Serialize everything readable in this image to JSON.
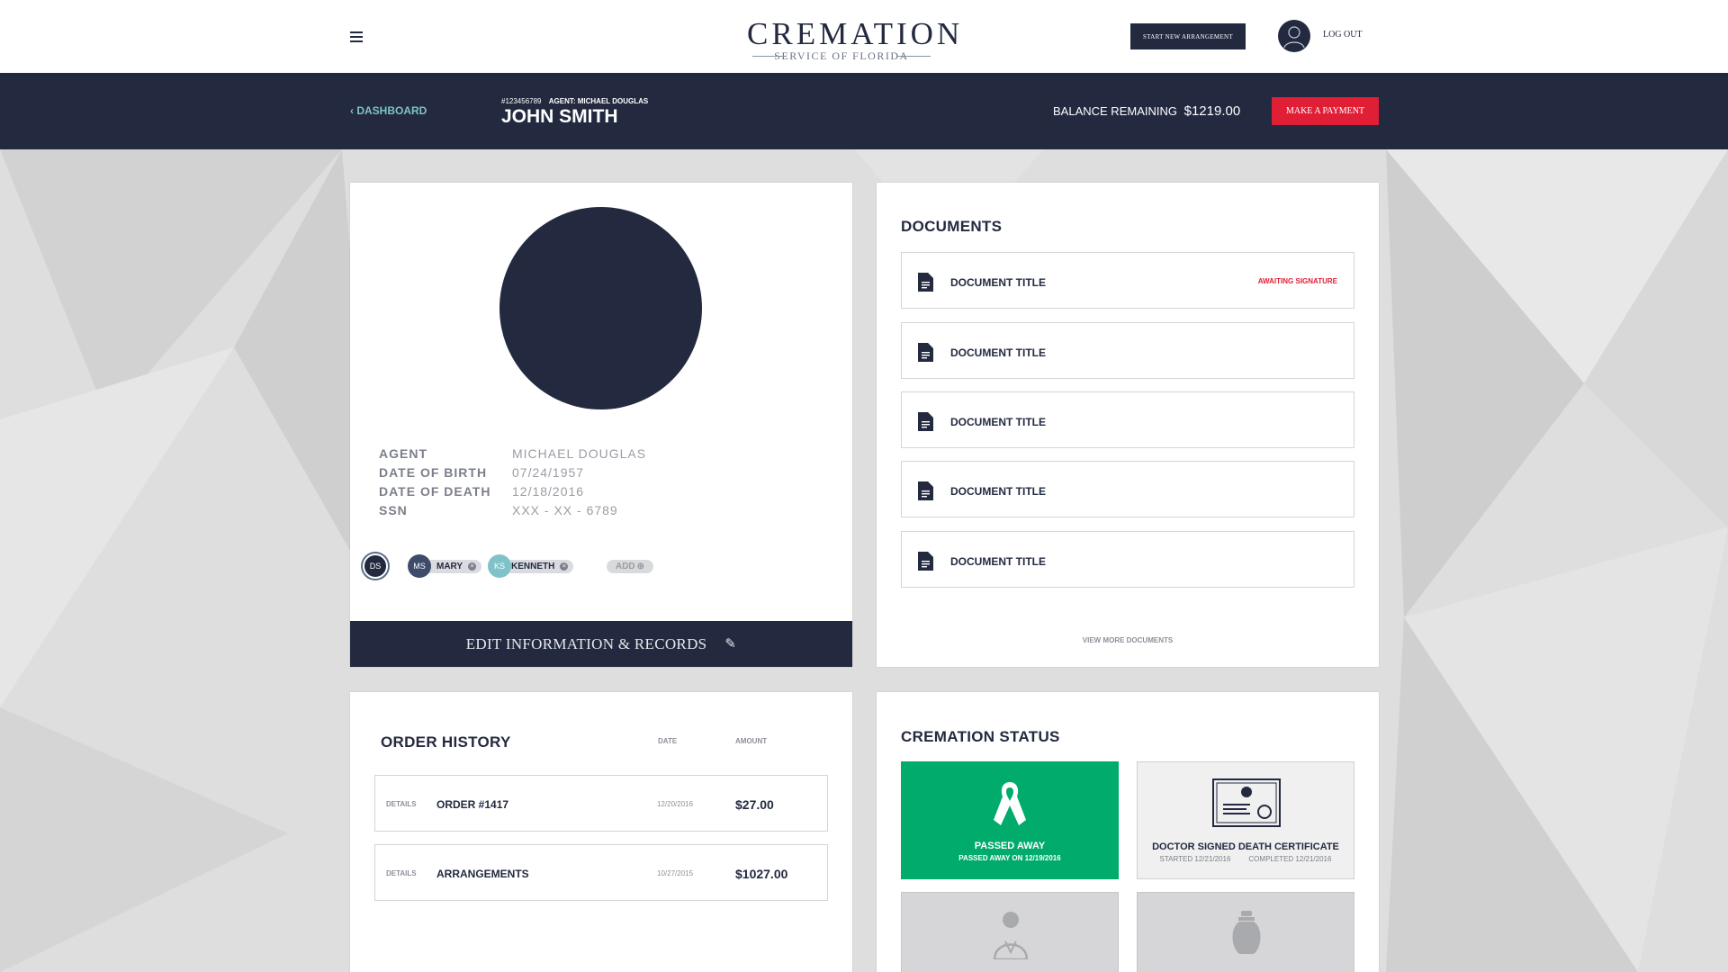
{
  "header": {
    "logo_main": "CREMATION",
    "logo_sub": "SERVICE OF FLORIDA",
    "start_button": "START NEW ARRANGEMENT",
    "logout": "LOG OUT"
  },
  "nav": {
    "back_label": "DASHBOARD",
    "case_number": "#123456789",
    "agent_label": "AGENT: MICHAEL DOUGLAS",
    "deceased_name": "JOHN SMITH",
    "balance_label": "BALANCE REMAINING",
    "balance_amount": "$1219.00",
    "pay_button": "MAKE A PAYMENT"
  },
  "profile": {
    "fields": [
      {
        "label": "AGENT",
        "value": "MICHAEL DOUGLAS"
      },
      {
        "label": "DATE OF BIRTH",
        "value": "07/24/1957"
      },
      {
        "label": "DATE OF DEATH",
        "value": "12/18/2016"
      },
      {
        "label": "SSN",
        "value": "XXX - XX - 6789"
      }
    ],
    "people": [
      {
        "initials": "DS"
      },
      {
        "initials": "MS",
        "name": "MARY"
      },
      {
        "initials": "KS",
        "name": "KENNETH"
      }
    ],
    "add_label": "ADD",
    "edit_label": "EDIT INFORMATION & RECORDS"
  },
  "documents": {
    "title": "DOCUMENTS",
    "items": [
      {
        "title": "DOCUMENT TITLE",
        "status": "AWAITING SIGNATURE"
      },
      {
        "title": "DOCUMENT TITLE",
        "status": ""
      },
      {
        "title": "DOCUMENT TITLE",
        "status": ""
      },
      {
        "title": "DOCUMENT TITLE",
        "status": ""
      },
      {
        "title": "DOCUMENT TITLE",
        "status": ""
      }
    ],
    "view_more": "VIEW MORE DOCUMENTS"
  },
  "orders": {
    "title": "ORDER HISTORY",
    "col_date": "DATE",
    "col_amount": "AMOUNT",
    "rows": [
      {
        "details": "DETAILS",
        "name": "ORDER #1417",
        "date": "12/20/2016",
        "amount": "$27.00"
      },
      {
        "details": "DETAILS",
        "name": "ARRANGEMENTS",
        "date": "10/27/2015",
        "amount": "$1027.00"
      }
    ]
  },
  "status": {
    "title": "CREMATION STATUS",
    "tiles": [
      {
        "title": "PASSED AWAY",
        "sub": "PASSED AWAY ON 12/19/2016",
        "icon": "ribbon-icon"
      },
      {
        "title": "DOCTOR SIGNED DEATH CERTIFICATE",
        "started": "STARTED 12/21/2016",
        "completed": "COMPLETED 12/21/2016",
        "icon": "certificate-icon"
      },
      {
        "icon": "doctor-icon"
      },
      {
        "icon": "urn-icon"
      }
    ]
  },
  "colors": {
    "navy": "#232a40",
    "teal": "#7fc2c9",
    "red": "#e01f36",
    "green": "#00ab6c"
  }
}
